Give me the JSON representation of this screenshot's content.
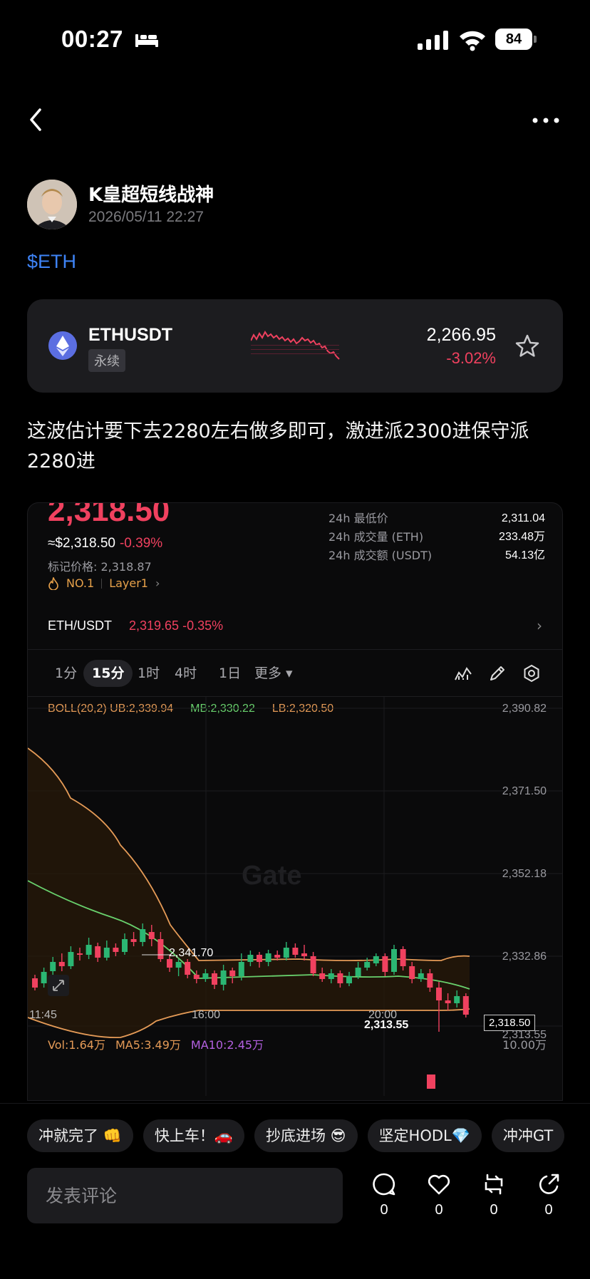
{
  "status_bar": {
    "time": "00:27",
    "battery": "84"
  },
  "post": {
    "author": "K皇超短线战神",
    "date": "2026/05/11 22:27",
    "tag": "$ETH",
    "text": "这波估计要下去2280左右做多即可，激进派2300进保守派2280进"
  },
  "ticker_card": {
    "pair": "ETHUSDT",
    "type": "永续",
    "price": "2,266.95",
    "change": "-3.02%",
    "change_color": "#f0415f"
  },
  "screenshot": {
    "big_price": "2,318.50",
    "usd_price": "≈$2,318.50",
    "usd_change": "-0.39%",
    "mark_price": "标记价格: 2,318.87",
    "rank": "NO.1",
    "category": "Layer1",
    "stats": [
      {
        "label": "24h 最低价",
        "value": "2,311.04"
      },
      {
        "label": "24h 成交量 (ETH)",
        "value": "233.48万"
      },
      {
        "label": "24h 成交额 (USDT)",
        "value": "54.13亿"
      }
    ],
    "pair": "ETH/USDT",
    "pair_price": "2,319.65",
    "pair_change": "-0.35%",
    "timeframes": [
      "1分",
      "15分",
      "1时",
      "4时",
      "1日",
      "更多"
    ],
    "active_timeframe": "15分",
    "boll": {
      "label": "BOLL(20,2) UB:2,339.94",
      "mb": "MB:2,330.22",
      "lb": "LB:2,320.50"
    },
    "price_axis": [
      "2,390.82",
      "2,371.50",
      "2,352.18",
      "2,332.86",
      "2,313.55"
    ],
    "time_axis": [
      "11:45",
      "16:00",
      "20:00"
    ],
    "high_marker": "2,341.70",
    "low_marker": "2,313.55",
    "last_price_tag": "2,318.50",
    "watermark": "Gate",
    "volume": {
      "vol": "Vol:1.64万",
      "ma5": "MA5:3.49万",
      "ma10": "MA10:2.45万",
      "max": "10.00万"
    }
  },
  "chips": [
    "冲就完了 👊",
    "快上车！🚗",
    "抄底进场 😎",
    "坚定HODL💎",
    "冲冲GT"
  ],
  "comment": {
    "placeholder": "发表评论"
  },
  "actions": [
    {
      "icon": "comment-icon",
      "count": "0"
    },
    {
      "icon": "like-icon",
      "count": "0"
    },
    {
      "icon": "repost-icon",
      "count": "0"
    },
    {
      "icon": "share-icon",
      "count": "0"
    }
  ]
}
